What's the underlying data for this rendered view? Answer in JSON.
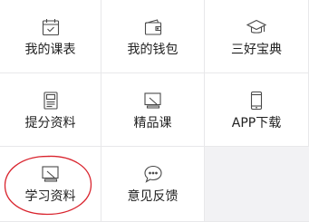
{
  "menu": {
    "items": [
      {
        "label": "我的课表",
        "icon": "calendar-icon"
      },
      {
        "label": "我的钱包",
        "icon": "wallet-icon"
      },
      {
        "label": "三好宝典",
        "icon": "graduation-cap-icon"
      },
      {
        "label": "提分资料",
        "icon": "document-icon"
      },
      {
        "label": "精品课",
        "icon": "slate-icon"
      },
      {
        "label": "APP下载",
        "icon": "phone-icon"
      },
      {
        "label": "学习资料",
        "icon": "slate-icon"
      },
      {
        "label": "意见反馈",
        "icon": "chat-bubble-icon"
      }
    ]
  },
  "colors": {
    "icon_stroke": "#4a4a4a",
    "text": "#222222",
    "annotation": "#d9242e",
    "background": "#f2f2f4"
  }
}
